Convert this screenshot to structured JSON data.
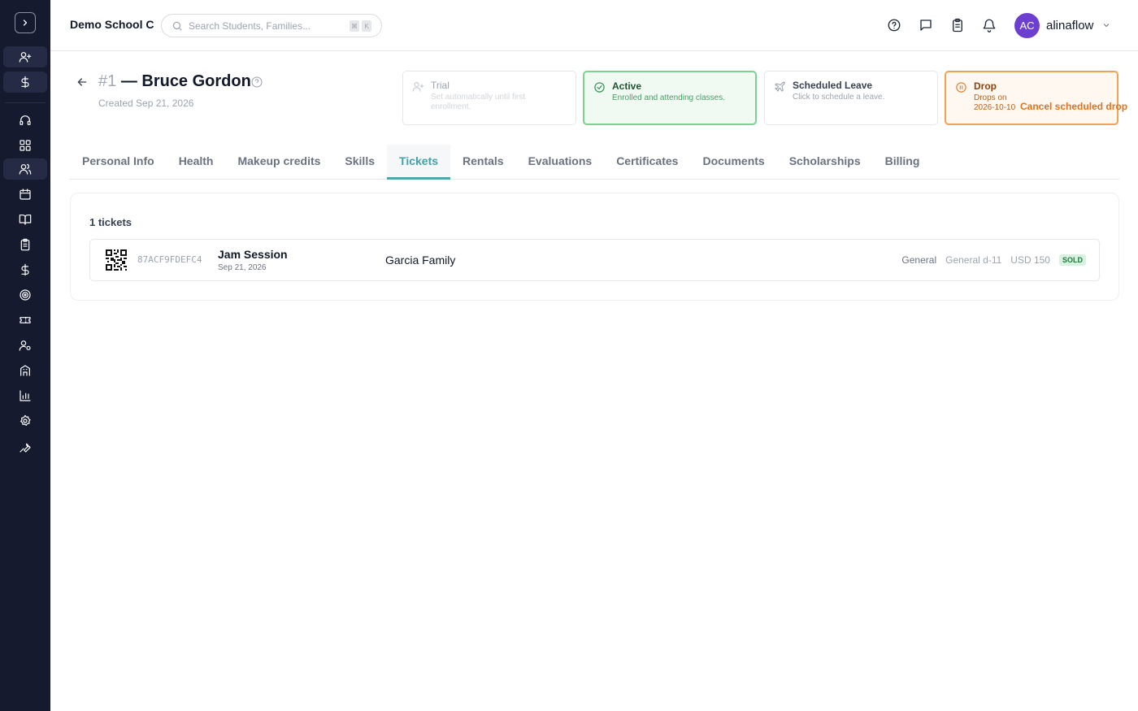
{
  "topbar": {
    "school_name": "Demo School C",
    "search_placeholder": "Search Students, Families...",
    "shortcut_keys": [
      "⌘",
      "K"
    ],
    "user": {
      "initials": "AC",
      "name": "alinaflow",
      "avatar_color": "#6d3fd1"
    }
  },
  "student": {
    "number": "#1",
    "name": "— Bruce Gordon",
    "created": "Created Sep 21, 2026"
  },
  "statuses": {
    "trial": {
      "title": "Trial",
      "desc": "Set automatically until first enrollment."
    },
    "active": {
      "title": "Active",
      "desc": "Enrolled and attending classes."
    },
    "leave": {
      "title": "Scheduled Leave",
      "desc": "Click to schedule a leave."
    },
    "drop": {
      "title": "Drop",
      "desc": "Drops on 2026-10-10",
      "action": "Cancel scheduled drop"
    }
  },
  "tabs": [
    "Personal Info",
    "Health",
    "Makeup credits",
    "Skills",
    "Tickets",
    "Rentals",
    "Evaluations",
    "Certificates",
    "Documents",
    "Scholarships",
    "Billing"
  ],
  "active_tab": "Tickets",
  "tickets": {
    "count_label": "1 tickets",
    "rows": [
      {
        "code": "87ACF9FDEFC4",
        "event": "Jam Session",
        "date": "Sep 21, 2026",
        "family": "Garcia Family",
        "type": "General",
        "seat": "General d-11",
        "price": "USD 150",
        "status": "SOLD"
      }
    ]
  },
  "colors": {
    "sidebar_bg": "#161a2e",
    "accent_teal": "#4aa8ad",
    "active_green": "#7ccf95",
    "drop_orange": "#f0a257"
  }
}
